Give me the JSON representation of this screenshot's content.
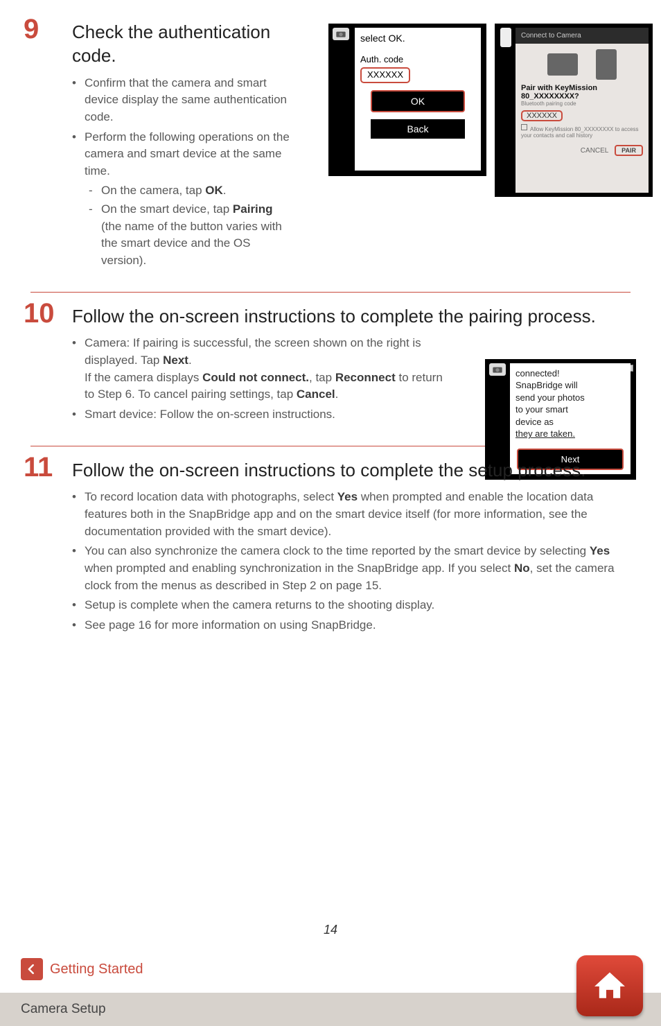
{
  "page_number": "14",
  "step9": {
    "num": "9",
    "title": "Check the authentication code.",
    "b1": "Confirm that the camera and smart device display the same authentication code.",
    "b2": "Perform the following operations on the camera and smart device at the same time.",
    "s1_pre": "On the camera, tap ",
    "s1_bold": "OK",
    "s1_post": ".",
    "s2_pre": "On the smart device, tap ",
    "s2_bold": "Pairing",
    "s2_post2": "(the name of the button varies with the smart device and the OS version).",
    "camera": {
      "select_ok": "select OK.",
      "auth_label": "Auth. code",
      "code": "XXXXXX",
      "ok": "OK",
      "back": "Back"
    },
    "phone": {
      "header": "Connect to Camera",
      "pair_line1": "Pair with KeyMission",
      "pair_line2": "80_XXXXXXXX?",
      "bt_label": "Bluetooth pairing code",
      "code": "XXXXXX",
      "allow": "Allow KeyMission 80_XXXXXXXX to access your contacts and call history",
      "cancel": "CANCEL",
      "pair": "PAIR"
    }
  },
  "step10": {
    "num": "10",
    "title": "Follow the on-screen instructions to complete the pairing process.",
    "b1_a": "Camera: If pairing is successful, the screen shown on the right is displayed. Tap ",
    "b1_bold1": "Next",
    "b1_b": ".",
    "b1_c": "If the camera displays ",
    "b1_bold2": "Could not connect.",
    "b1_d": ", tap ",
    "b1_bold3": "Reconnect",
    "b1_e": " to return to Step 6. To cancel pairing settings, tap ",
    "b1_bold4": "Cancel",
    "b1_f": ".",
    "b2": "Smart device: Follow the on-screen instructions.",
    "camera": {
      "l1": "connected!",
      "l2": "SnapBridge will",
      "l3": "send your photos",
      "l4": "to your smart",
      "l5": "device as",
      "l6": "they are taken.",
      "next": "Next"
    }
  },
  "step11": {
    "num": "11",
    "title": "Follow the on-screen instructions to complete the setup process.",
    "b1_a": "To record location data with photographs, select ",
    "b1_bold": "Yes",
    "b1_b": " when prompted and enable the location data features both in the SnapBridge app and on the smart device itself (for more information, see the documentation provided with the smart device).",
    "b2_a": "You can also synchronize the camera clock to the time reported by the smart device by selecting ",
    "b2_bold1": "Yes",
    "b2_b": " when prompted and enabling synchronization in the SnapBridge app. If you select ",
    "b2_bold2": "No",
    "b2_c": ", set the camera clock from the menus as described in Step 2 on page 15.",
    "b3": "Setup is complete when the camera returns to the shooting display.",
    "b4": "See page 16 for more information on using SnapBridge."
  },
  "footer": {
    "back_label": "Getting Started",
    "bar_label": "Camera Setup"
  }
}
